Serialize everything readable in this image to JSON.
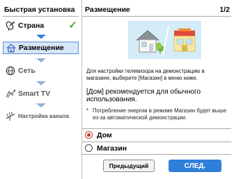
{
  "sidebar": {
    "title": "Быстрая установка",
    "items": [
      {
        "label": "Страна",
        "icon": "satellite-dish-icon",
        "state": "done"
      },
      {
        "label": "Размещение",
        "icon": "home-icon",
        "state": "active"
      },
      {
        "label": "Сеть",
        "icon": "globe-icon",
        "state": "pending"
      },
      {
        "label": "Smart TV",
        "icon": "smart-tv-icon",
        "state": "pending"
      },
      {
        "label": "Настройка канала",
        "icon": "antenna-icon",
        "state": "pending"
      }
    ],
    "check_mark": "✓"
  },
  "panel": {
    "title": "Размещение",
    "page": "1/2",
    "description": "Для настройки телевизора на демонстрацию в магазине, выберите [Магазин] в меню ниже.",
    "recommendation": "[Дом] рекомендуется для обычного использования.",
    "note_marker": "*",
    "note": "Потребление энергии в режиме Магазин будет выше из-за автоматической демонстрации.",
    "options": [
      {
        "label": "Дом",
        "selected": true
      },
      {
        "label": "Магазин",
        "selected": false
      }
    ],
    "buttons": {
      "prev": "Предыдущий",
      "next": "СЛЕД."
    }
  },
  "colors": {
    "accent": "#2f7fd8",
    "active_bg": "#d7e6f8",
    "check": "#5aa02c",
    "radio_selected": "#c0392b",
    "illustration_bg": "#d3ecf7"
  }
}
